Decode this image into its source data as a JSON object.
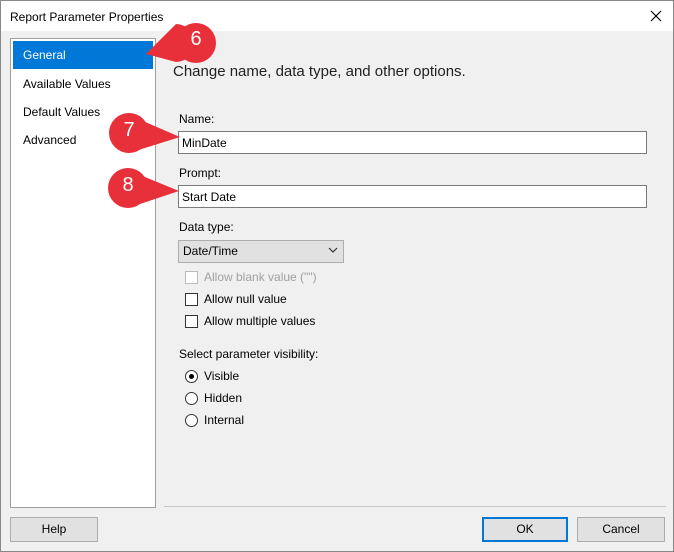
{
  "window": {
    "title": "Report Parameter Properties"
  },
  "nav": {
    "items": [
      {
        "label": "General",
        "selected": true
      },
      {
        "label": "Available Values",
        "selected": false
      },
      {
        "label": "Default Values",
        "selected": false
      },
      {
        "label": "Advanced",
        "selected": false
      }
    ]
  },
  "general": {
    "heading": "Change name, data type, and other options.",
    "name_label": "Name:",
    "name_value": "MinDate",
    "prompt_label": "Prompt:",
    "prompt_value": "Start Date",
    "datatype_label": "Data type:",
    "datatype_value": "Date/Time",
    "allow_blank_label": "Allow blank value (\"\")",
    "allow_null_label": "Allow null value",
    "allow_multiple_label": "Allow multiple values",
    "visibility_label": "Select parameter visibility:",
    "visibility_options": [
      "Visible",
      "Hidden",
      "Internal"
    ],
    "visibility_selected": "Visible"
  },
  "buttons": {
    "help": "Help",
    "ok": "OK",
    "cancel": "Cancel"
  },
  "callouts": [
    "6",
    "7",
    "8"
  ],
  "colors": {
    "selection": "#0078d7",
    "callout": "#e8303a"
  }
}
